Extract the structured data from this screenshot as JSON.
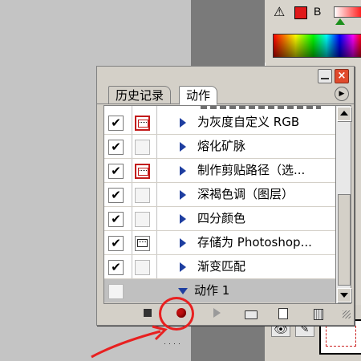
{
  "background": {
    "color_label": "B",
    "warning_icon": "warning-triangle-icon",
    "accent_red": "#e0191a"
  },
  "panel": {
    "tabs": [
      {
        "label": "历史记录"
      },
      {
        "label": "动作"
      }
    ],
    "active_tab": "动作",
    "rows": [
      {
        "checked": true,
        "dialog": "red",
        "label": "为灰度自定义 RGB",
        "expanded": false
      },
      {
        "checked": true,
        "dialog": "empty",
        "label": "熔化矿脉",
        "expanded": false
      },
      {
        "checked": true,
        "dialog": "red",
        "label": "制作剪贴路径（选...",
        "expanded": false
      },
      {
        "checked": true,
        "dialog": "empty",
        "label": "深褐色调（图层）",
        "expanded": false
      },
      {
        "checked": true,
        "dialog": "empty",
        "label": "四分颜色",
        "expanded": false
      },
      {
        "checked": true,
        "dialog": "on",
        "label": "存储为 Photoshop...",
        "expanded": false
      },
      {
        "checked": true,
        "dialog": "empty",
        "label": "渐变匹配",
        "expanded": false
      },
      {
        "checked": false,
        "dialog": "none",
        "label": "动作 1",
        "expanded": true,
        "selected": true
      }
    ],
    "toolbar": [
      "stop-icon",
      "record-icon",
      "play-icon",
      "new-set-icon",
      "new-action-icon",
      "delete-icon"
    ]
  },
  "colors": {
    "annotation": "#e82020",
    "triangle": "#1e3ea0"
  }
}
